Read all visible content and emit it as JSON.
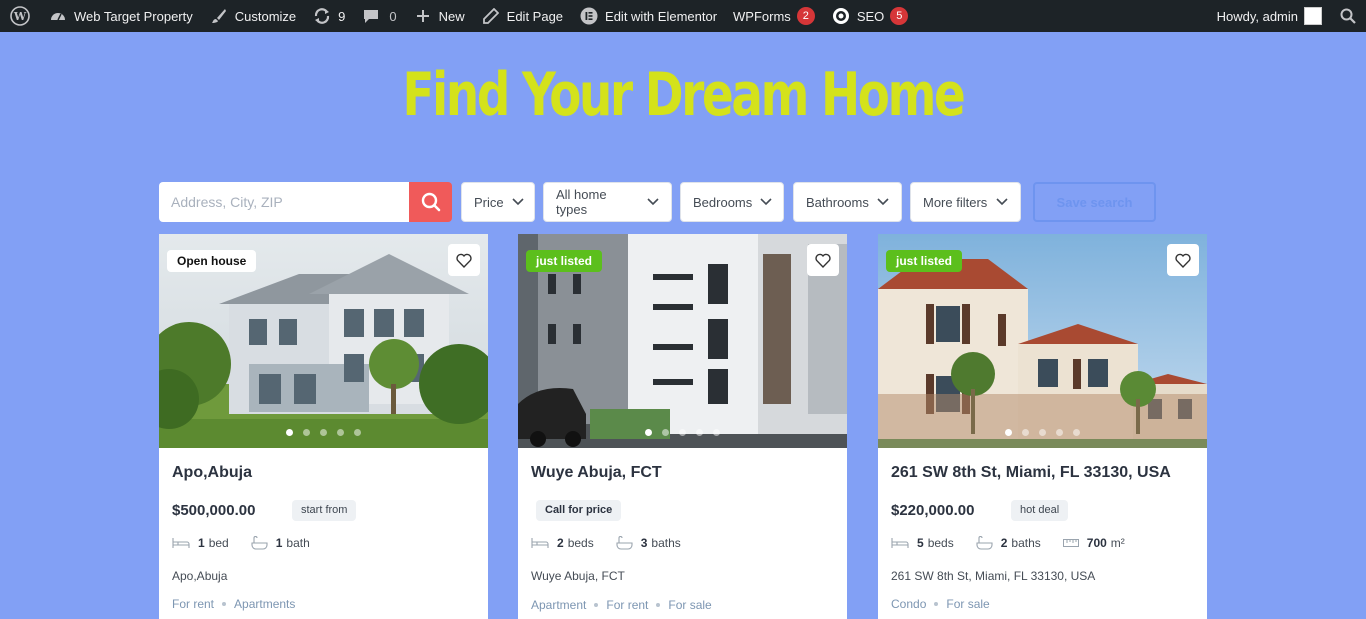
{
  "adminbar": {
    "site_name": "Web Target Property",
    "customize": "Customize",
    "updates_count": "9",
    "comments_count": "0",
    "new": "New",
    "edit_page": "Edit Page",
    "edit_elementor": "Edit with Elementor",
    "wpforms": "WPForms",
    "wpforms_count": "2",
    "seo": "SEO",
    "seo_count": "5",
    "howdy": "Howdy, admin"
  },
  "hero": {
    "title": "Find Your Dream Home"
  },
  "search": {
    "placeholder": "Address, City, ZIP",
    "filters": [
      "Price",
      "All home types",
      "Bedrooms",
      "Bathrooms",
      "More filters"
    ],
    "save_label": "Save search"
  },
  "listings": [
    {
      "badge": "Open house",
      "title": "Apo,Abuja",
      "price": "$500,000.00",
      "tag": "start from",
      "beds": "1",
      "beds_label": "bed",
      "baths": "1",
      "baths_label": "bath",
      "address": "Apo,Abuja",
      "categories": [
        "For rent",
        "Apartments"
      ]
    },
    {
      "badge": "just listed",
      "title": "Wuye Abuja, FCT",
      "price": "",
      "tag": "Call for price",
      "beds": "2",
      "beds_label": "beds",
      "baths": "3",
      "baths_label": "baths",
      "address": "Wuye Abuja, FCT",
      "categories": [
        "Apartment",
        "For rent",
        "For sale"
      ]
    },
    {
      "badge": "just listed",
      "title": "261 SW 8th St, Miami, FL 33130, USA",
      "price": "$220,000.00",
      "tag": "hot deal",
      "beds": "5",
      "beds_label": "beds",
      "baths": "2",
      "baths_label": "baths",
      "area": "700",
      "area_unit": "m²",
      "address": "261 SW 8th St, Miami, FL 33130, USA",
      "categories": [
        "Condo",
        "For sale"
      ]
    }
  ],
  "colors": {
    "background": "#82a0f5",
    "title": "#d4e21b",
    "accent": "#f05a5a",
    "badge_green": "#5cbf1c"
  }
}
